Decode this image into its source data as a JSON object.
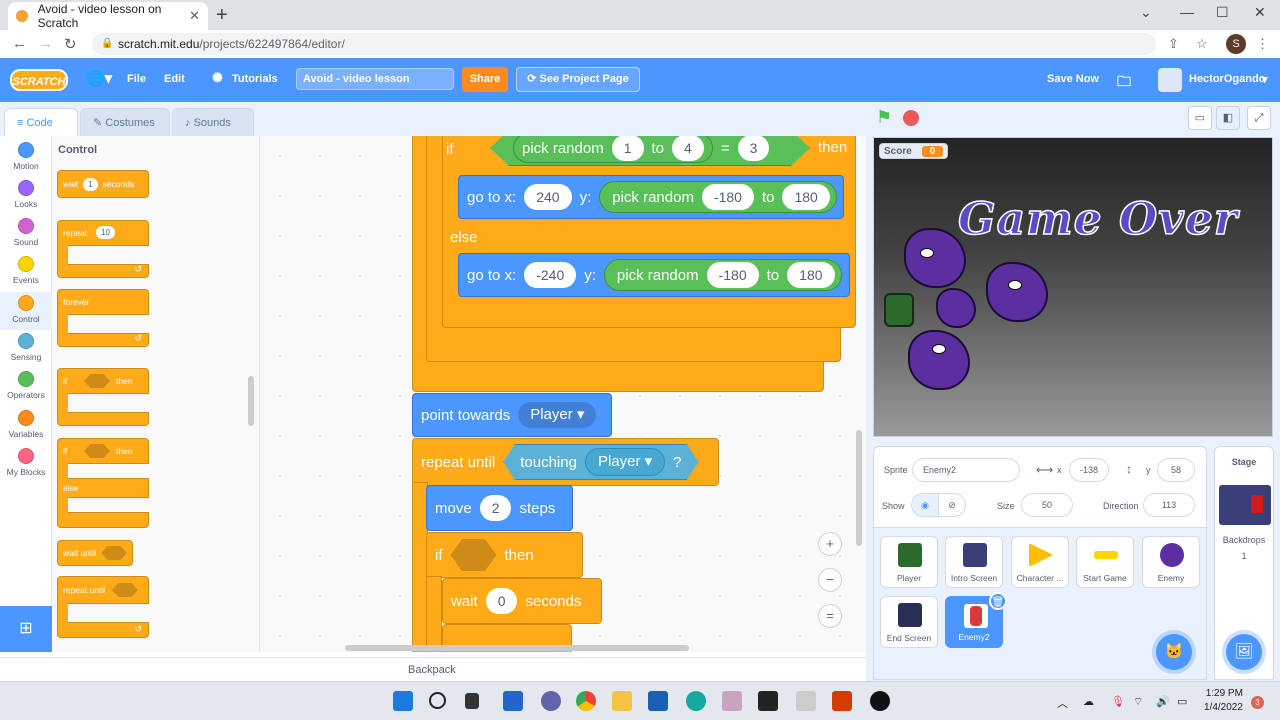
{
  "browser": {
    "tab_title": "Avoid - video lesson on Scratch",
    "url_host": "scratch.mit.edu",
    "url_path": "/projects/622497864/editor/",
    "profile_initial": "S"
  },
  "menubar": {
    "logo": "SCRATCH",
    "file": "File",
    "edit": "Edit",
    "tutorials": "Tutorials",
    "project_title": "Avoid - video lesson",
    "share": "Share",
    "see_project_page": "See Project Page",
    "save_now": "Save Now",
    "username": "HectorOgando"
  },
  "editor_tabs": {
    "code": "Code",
    "costumes": "Costumes",
    "sounds": "Sounds"
  },
  "categories": [
    {
      "label": "Motion",
      "color": "#4c97ff"
    },
    {
      "label": "Looks",
      "color": "#9966ff"
    },
    {
      "label": "Sound",
      "color": "#cf63cf"
    },
    {
      "label": "Events",
      "color": "#ffd500"
    },
    {
      "label": "Control",
      "color": "#ffab19"
    },
    {
      "label": "Sensing",
      "color": "#5cb1d6"
    },
    {
      "label": "Operators",
      "color": "#59c059"
    },
    {
      "label": "Variables",
      "color": "#ff8c1a"
    },
    {
      "label": "My Blocks",
      "color": "#ff6680"
    }
  ],
  "palette": {
    "title": "Control",
    "wait": "wait",
    "wait_val": "1",
    "seconds": "seconds",
    "repeat": "repeat",
    "repeat_val": "10",
    "forever": "forever",
    "if": "if",
    "then": "then",
    "if2": "if",
    "then2": "then",
    "else": "else",
    "wait_until": "wait until",
    "repeat_until": "repeat until"
  },
  "script": {
    "if": "if",
    "pick_random": "pick random",
    "r1_from": "1",
    "to": "to",
    "r1_to": "4",
    "eq": "=",
    "eq_val": "3",
    "then": "then",
    "goto_x": "go to x:",
    "x1": "240",
    "y_label": "y:",
    "r2_from": "-180",
    "r2_to": "180",
    "else": "else",
    "x2": "-240",
    "r3_from": "-180",
    "r3_to": "180",
    "point_towards": "point towards",
    "player_dd": "Player",
    "repeat_until": "repeat until",
    "touching": "touching",
    "touching_dd": "Player",
    "qmark": "?",
    "move": "move",
    "move_val": "2",
    "steps": "steps",
    "if2": "if",
    "then2": "then",
    "wait": "wait",
    "wait_val": "0",
    "seconds": "seconds"
  },
  "zoom": {
    "in": "+",
    "out": "−",
    "reset": "="
  },
  "backpack": "Backpack",
  "stage": {
    "score_label": "Score",
    "score_value": "0",
    "game_over": "Game Over"
  },
  "sprite_info": {
    "sprite_label": "Sprite",
    "sprite_name": "Enemy2",
    "x_label": "x",
    "x_val": "-138",
    "y_label": "y",
    "y_val": "58",
    "show_label": "Show",
    "size_label": "Size",
    "size_val": "50",
    "direction_label": "Direction",
    "direction_val": "113"
  },
  "sprites": [
    {
      "name": "Player",
      "color": "#2c6b2c"
    },
    {
      "name": "Intro Screen",
      "color": "#3a3f7a"
    },
    {
      "name": "Character ...",
      "color": "#ffbf00"
    },
    {
      "name": "Start Game",
      "color": "#ffd500"
    },
    {
      "name": "Enemy",
      "color": "#5b2fa0"
    },
    {
      "name": "End Screen",
      "color": "#2a2f55"
    },
    {
      "name": "Enemy2",
      "color": "#d93a3a"
    }
  ],
  "stage_panel": {
    "title": "Stage",
    "backdrops_label": "Backdrops",
    "backdrops_count": "1"
  },
  "taskbar": {
    "time": "1:29 PM",
    "date": "1/4/2022",
    "notif": "3"
  }
}
